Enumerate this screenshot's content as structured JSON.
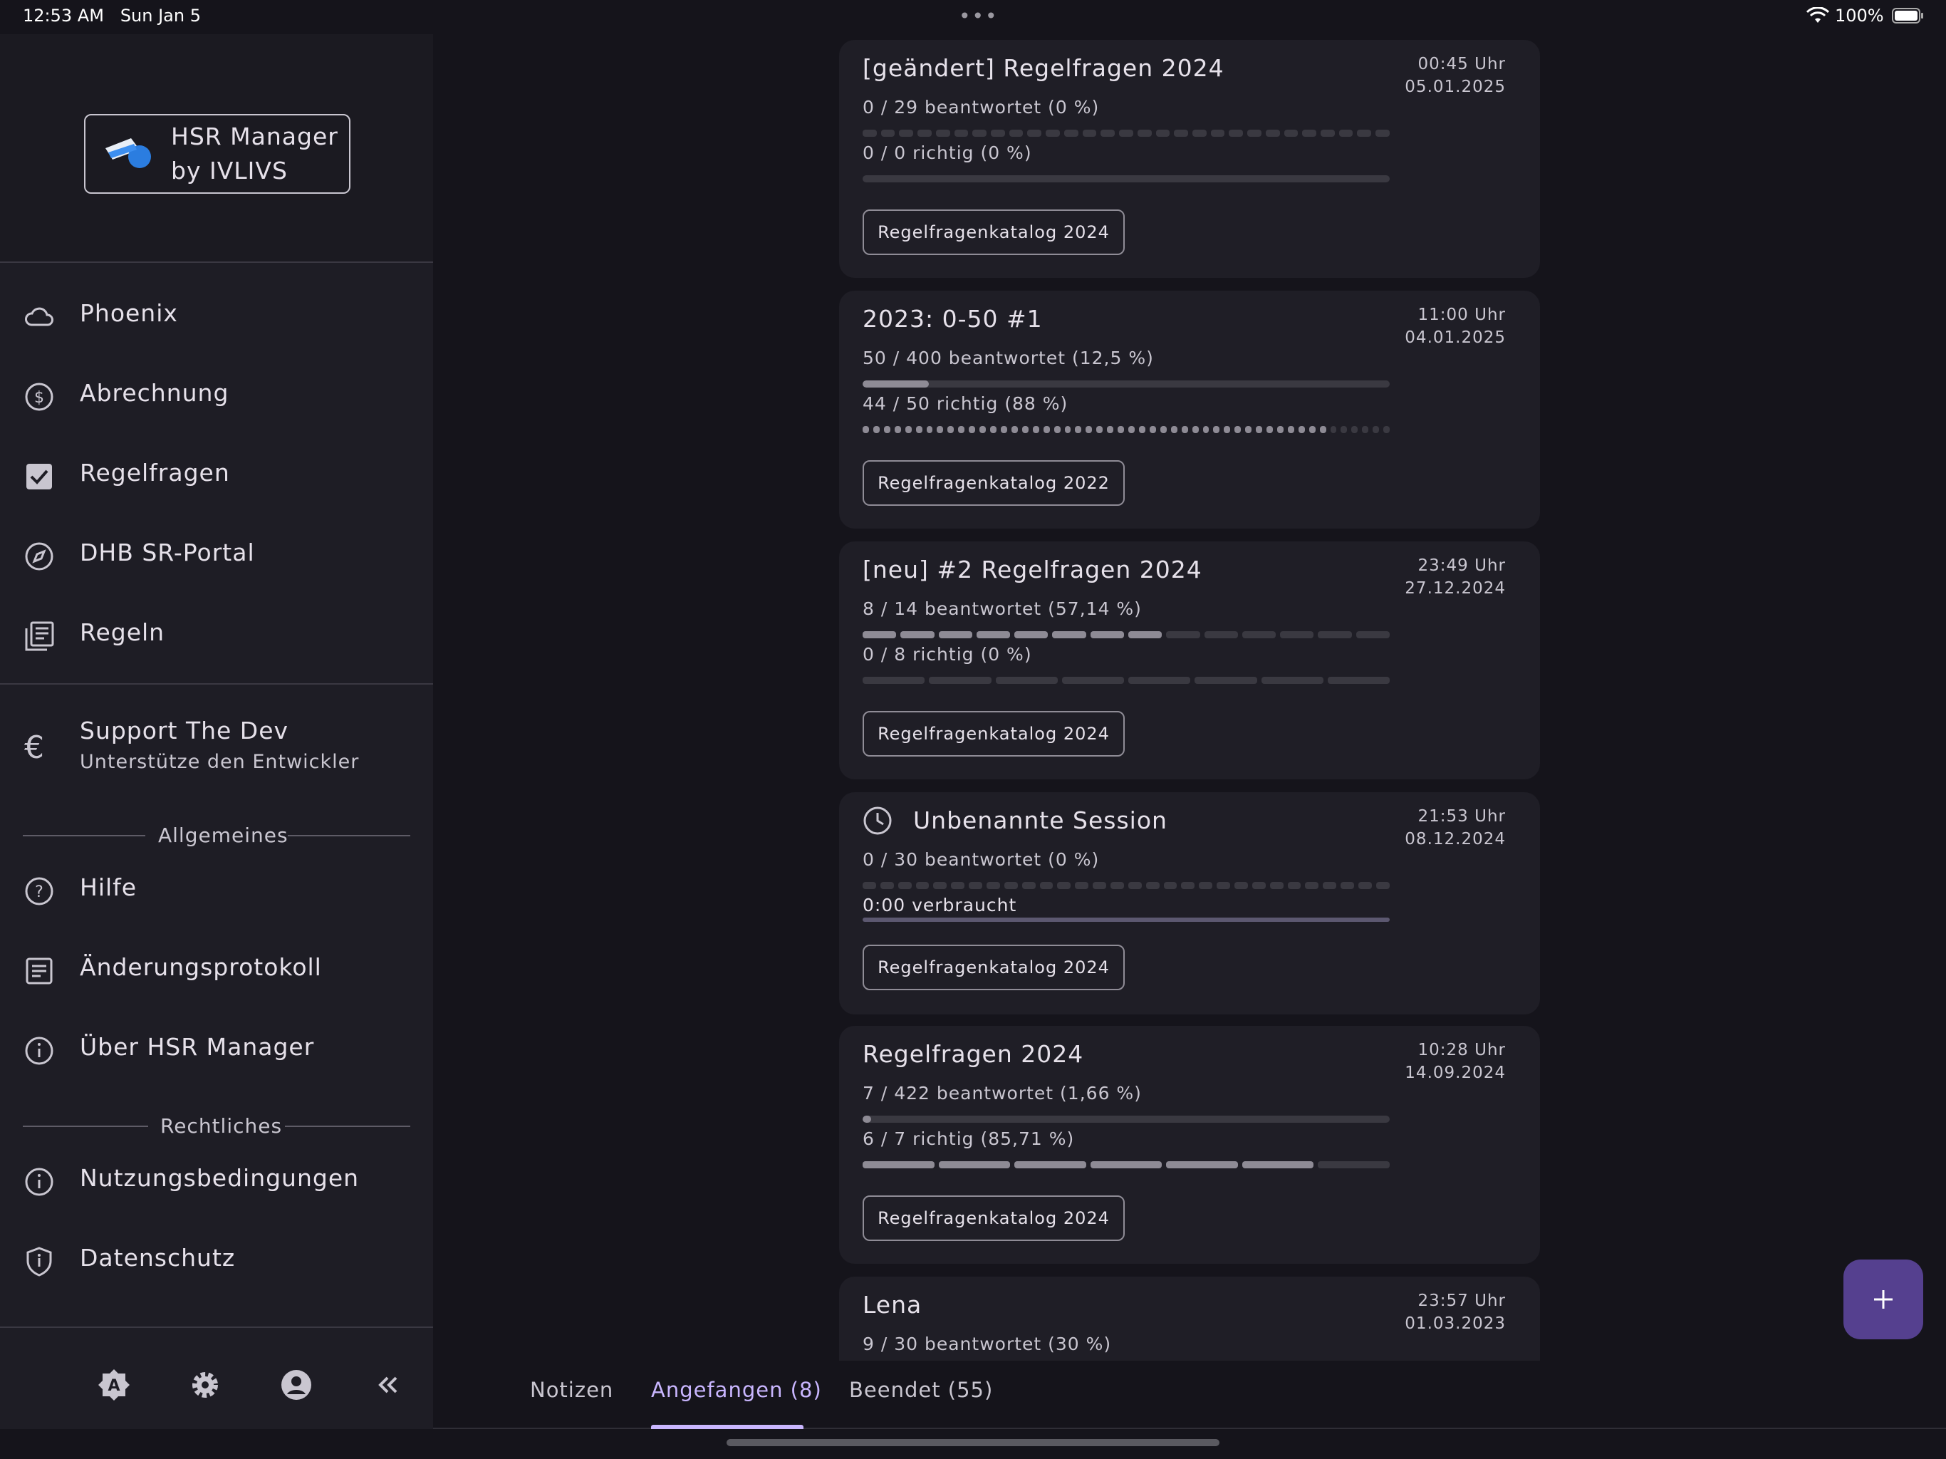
{
  "status_bar": {
    "time": "12:53 AM",
    "date": "Sun Jan 5",
    "battery": "100%"
  },
  "logo": {
    "line1": "HSR Manager",
    "line2": "by IVLIVS"
  },
  "nav": [
    {
      "label": "Phoenix",
      "icon": "cloud-icon"
    },
    {
      "label": "Abrechnung",
      "icon": "dollar-circle-icon"
    },
    {
      "label": "Regelfragen",
      "icon": "checkbox-icon"
    },
    {
      "label": "DHB SR-Portal",
      "icon": "compass-icon"
    },
    {
      "label": "Regeln",
      "icon": "document-stack-icon"
    }
  ],
  "support": {
    "title": "Support The Dev",
    "subtitle": "Unterstütze den Entwickler"
  },
  "sections": {
    "general": "Allgemeines",
    "legal": "Rechtliches"
  },
  "general_items": [
    {
      "label": "Hilfe",
      "icon": "help-circle-icon"
    },
    {
      "label": "Änderungsprotokoll",
      "icon": "changelog-icon"
    },
    {
      "label": "Über HSR Manager",
      "icon": "info-icon"
    }
  ],
  "legal_items": [
    {
      "label": "Nutzungsbedingungen",
      "icon": "info-icon"
    },
    {
      "label": "Datenschutz",
      "icon": "shield-icon"
    }
  ],
  "footer_icons": [
    "font-a-icon",
    "gear-icon",
    "account-icon",
    "collapse-icon"
  ],
  "cards": [
    {
      "title": "[geändert] Regelfragen 2024",
      "time": "00:45 Uhr",
      "date": "05.01.2025",
      "answered": "0 / 29 beantwortet (0 %)",
      "answered_segments": 29,
      "answered_done": 0,
      "correct": "0 / 0 richtig (0 %)",
      "correct_segments": 0,
      "correct_done": 0,
      "catalog": "Regelfragenkatalog 2024"
    },
    {
      "title": "2023: 0-50 #1",
      "time": "11:00 Uhr",
      "date": "04.01.2025",
      "answered": "50 / 400 beantwortet (12,5 %)",
      "answered_fraction": 0.125,
      "correct": "44 / 50 richtig (88 %)",
      "correct_segments": 50,
      "correct_done": 44,
      "catalog": "Regelfragenkatalog 2022"
    },
    {
      "title": "[neu] #2 Regelfragen 2024",
      "time": "23:49 Uhr",
      "date": "27.12.2024",
      "answered": "8 / 14 beantwortet (57,14 %)",
      "answered_segments": 14,
      "answered_done": 8,
      "correct": "0 / 8 richtig (0 %)",
      "correct_segments": 8,
      "correct_done": 0,
      "catalog": "Regelfragenkatalog 2024"
    },
    {
      "title": "Unbenannte Session",
      "time": "21:53 Uhr",
      "date": "08.12.2024",
      "answered": "0 / 30 beantwortet (0 %)",
      "answered_segments": 30,
      "answered_done": 0,
      "extra": "0:00 verbraucht",
      "catalog": "Regelfragenkatalog 2024"
    },
    {
      "title": "Regelfragen 2024",
      "time": "10:28 Uhr",
      "date": "14.09.2024",
      "answered": "7 / 422 beantwortet (1,66 %)",
      "answered_fraction": 0.0166,
      "correct": "6 / 7 richtig (85,71 %)",
      "correct_segments": 7,
      "correct_done": 6,
      "catalog": "Regelfragenkatalog 2024"
    },
    {
      "title": "Lena",
      "time": "23:57 Uhr",
      "date": "01.03.2023",
      "answered": "9 / 30 beantwortet (30 %)"
    }
  ],
  "tabs": [
    {
      "label": "Notizen",
      "active": false
    },
    {
      "label": "Angefangen (8)",
      "active": true
    },
    {
      "label": "Beendet (55)",
      "active": false
    }
  ],
  "fab": {
    "icon": "plus-icon"
  },
  "colors": {
    "background": "#15141b",
    "sidebar": "#1e1d25",
    "card": "#1f1e26",
    "accent": "#c9b6ff",
    "fab": "#55408f"
  }
}
